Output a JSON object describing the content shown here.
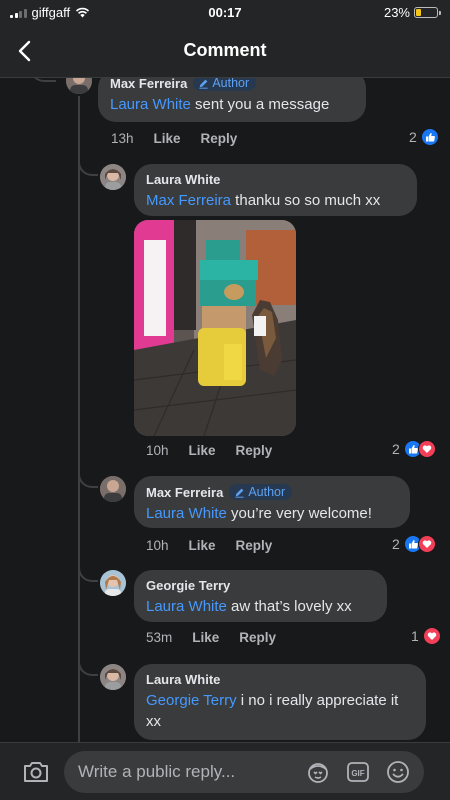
{
  "status_bar": {
    "carrier": "giffgaff",
    "time": "00:17",
    "battery": "23%",
    "battery_level": 0.23
  },
  "header": {
    "title": "Comment"
  },
  "comments": [
    {
      "name": "Max Ferreira",
      "badge": "Author",
      "mention": "Laura White",
      "text": " sent you a message",
      "time": "13h",
      "like": "Like",
      "reply": "Reply",
      "react_count": "2"
    },
    {
      "name": "Laura White",
      "mention": "Max Ferreira",
      "text": " thanku so so much xx",
      "time": "10h",
      "like": "Like",
      "reply": "Reply",
      "react_count": "2"
    },
    {
      "name": "Max Ferreira",
      "badge": "Author",
      "mention": "Laura White",
      "text": " you’re very welcome!",
      "time": "10h",
      "like": "Like",
      "reply": "Reply",
      "react_count": "2"
    },
    {
      "name": "Georgie Terry",
      "mention": "Laura White",
      "text": " aw that’s lovely xx",
      "time": "53m",
      "like": "Like",
      "reply": "Reply",
      "react_count": "1"
    },
    {
      "name": "Laura White",
      "mention": "Georgie Terry",
      "text": " i no i really appreciate it xx"
    }
  ],
  "composer": {
    "placeholder": "Write a public reply..."
  },
  "icons": [
    "back-chevron-icon",
    "camera-icon",
    "sticker-icon",
    "gif-icon",
    "emoji-icon",
    "like-reaction-icon",
    "love-reaction-icon",
    "pencil-icon"
  ],
  "colors": {
    "background": "#18191a",
    "bubble": "#3a3b3c",
    "mention": "#4599ff",
    "like": "#1877f2",
    "love": "#f33e58",
    "battery": "#f5c518"
  }
}
